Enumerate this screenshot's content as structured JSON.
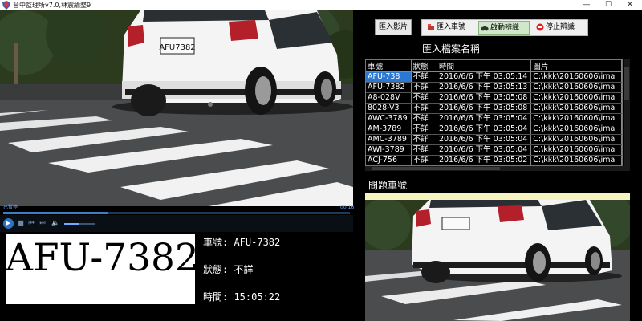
{
  "window": {
    "title": "台中監理所v7.0,林震綸整9",
    "minimize": "—",
    "maximize": "☐",
    "close": "✕"
  },
  "video": {
    "plate_on_car": "AFU7382",
    "mode_text": "已暫停",
    "time_text": "00:16",
    "seek_progress": 0.3,
    "volume_level": 0.5
  },
  "toolbar": {
    "import_video": "匯入影片",
    "import_plates": "匯入車號",
    "start_recognition": "啟動辨識",
    "stop_recognition": "停止辨識"
  },
  "file_section_title": "匯入檔案名稱",
  "grid": {
    "headers": [
      "車號",
      "狀態",
      "時間",
      "圖片"
    ],
    "rows": [
      [
        "AFU-738",
        "不詳",
        "2016/6/6 下午 03:05:14",
        "C:\\kkk\\20160606\\ima"
      ],
      [
        "AFU-7382",
        "不詳",
        "2016/6/6 下午 03:05:13",
        "C:\\kkk\\20160606\\ima"
      ],
      [
        "A8-028V",
        "不詳",
        "2016/6/6 下午 03:05:08",
        "C:\\kkk\\20160606\\ima"
      ],
      [
        "8028-V3",
        "不詳",
        "2016/6/6 下午 03:05:08",
        "C:\\kkk\\20160606\\ima"
      ],
      [
        "AWC-3789",
        "不詳",
        "2016/6/6 下午 03:05:04",
        "C:\\kkk\\20160606\\ima"
      ],
      [
        "AM-3789",
        "不詳",
        "2016/6/6 下午 03:05:04",
        "C:\\kkk\\20160606\\ima"
      ],
      [
        "AMC-3789",
        "不詳",
        "2016/6/6 下午 03:05:04",
        "C:\\kkk\\20160606\\ima"
      ],
      [
        "AWI-3789",
        "不詳",
        "2016/6/6 下午 03:05:04",
        "C:\\kkk\\20160606\\ima"
      ],
      [
        "ACJ-756",
        "不詳",
        "2016/6/6 下午 03:05:02",
        "C:\\kkk\\20160606\\ima"
      ]
    ]
  },
  "problem_section_title": "問題車號",
  "plate_display": "AFU-7382",
  "info": {
    "plate_line": "車號: AFU-7382",
    "status_line": "狀態: 不詳",
    "time_line": "時間: 15:05:22"
  },
  "colors": {
    "selection": "#2a77d4",
    "highlight_bar": "#f5f4c0",
    "active_button": "#cfe8c9",
    "stop_icon": "#e02020"
  }
}
